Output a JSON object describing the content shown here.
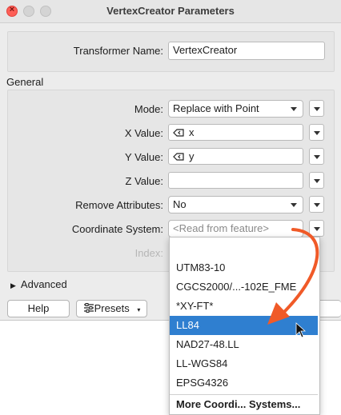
{
  "window": {
    "title": "VertexCreator Parameters"
  },
  "transformer": {
    "label": "Transformer Name:",
    "value": "VertexCreator"
  },
  "general": {
    "heading": "General",
    "mode": {
      "label": "Mode:",
      "value": "Replace with Point"
    },
    "x": {
      "label": "X Value:",
      "value": "x"
    },
    "y": {
      "label": "Y Value:",
      "value": "y"
    },
    "z": {
      "label": "Z Value:",
      "value": ""
    },
    "remove": {
      "label": "Remove Attributes:",
      "value": "No"
    },
    "coord": {
      "label": "Coordinate System:",
      "placeholder": "<Read from feature>"
    },
    "index": {
      "label": "Index:"
    }
  },
  "advanced": {
    "label": "Advanced"
  },
  "buttons": {
    "help": "Help",
    "presets": "Presets"
  },
  "dropdown": {
    "items": [
      "UTM83-10",
      "CGCS2000/...-102E_FME",
      "*XY-FT*",
      "LL84",
      "NAD27-48.LL",
      "LL-WGS84",
      "EPSG4326"
    ],
    "more": "More Coordi... Systems...",
    "selected_index": 3
  },
  "colors": {
    "selection": "#2f7fd0",
    "arrow": "#f05a28"
  }
}
